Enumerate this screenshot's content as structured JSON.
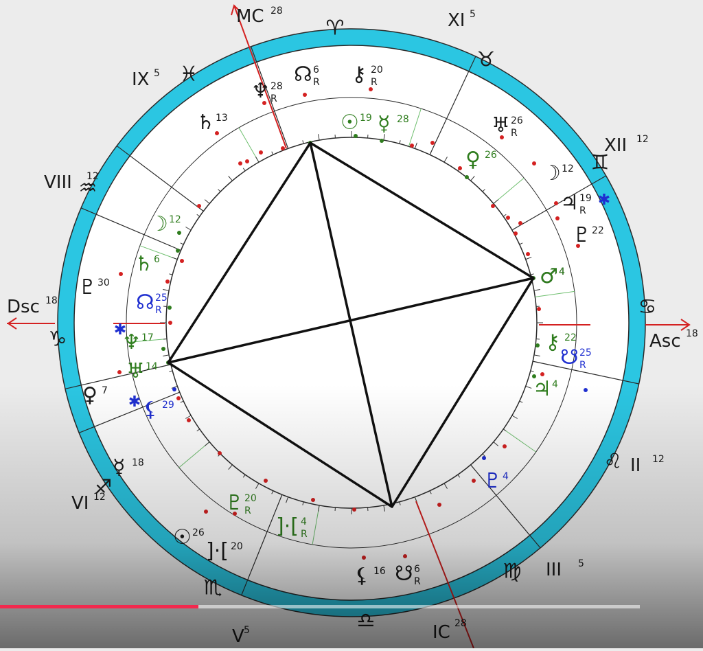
{
  "colors": {
    "ring": "#2bc6e2",
    "ring_edge": "#2a2a2a",
    "natal": "#1a1a1a",
    "transit": "#2f7d1e",
    "progressed": "#1f2fd0",
    "axis": "#d42121",
    "aspect": "#111111",
    "progress": "#f2294e"
  },
  "axes": {
    "mc": {
      "label": "MC",
      "deg": "28"
    },
    "ic": {
      "label": "IC",
      "deg": "28"
    },
    "asc": {
      "label": "Asc",
      "deg": "18"
    },
    "dsc": {
      "label": "Dsc",
      "deg": "18"
    }
  },
  "signs": [
    {
      "name": "aries-glyph",
      "glyph": "♈"
    },
    {
      "name": "taurus-glyph",
      "glyph": "♉"
    },
    {
      "name": "gemini-glyph",
      "glyph": "♊"
    },
    {
      "name": "cancer-glyph",
      "glyph": "♋"
    },
    {
      "name": "leo-glyph",
      "glyph": "♌"
    },
    {
      "name": "virgo-glyph",
      "glyph": "♍"
    },
    {
      "name": "libra-glyph",
      "glyph": "♎"
    },
    {
      "name": "scorpio-glyph",
      "glyph": "♏"
    },
    {
      "name": "sagittarius-glyph",
      "glyph": "♐"
    },
    {
      "name": "capricorn-glyph",
      "glyph": "♑"
    },
    {
      "name": "aquarius-glyph",
      "glyph": "♒"
    },
    {
      "name": "pisces-glyph",
      "glyph": "♓"
    }
  ],
  "houses": [
    {
      "label": "XI",
      "deg": "5"
    },
    {
      "label": "XII",
      "deg": "12"
    },
    {
      "label": "II",
      "deg": "12"
    },
    {
      "label": "III",
      "deg": "5"
    },
    {
      "label": "V",
      "deg": "5"
    },
    {
      "label": "VI",
      "deg": "12"
    },
    {
      "label": "VIII",
      "deg": "12"
    },
    {
      "label": "IX",
      "deg": "5"
    }
  ],
  "natal": [
    {
      "name": "node-north-natal",
      "glyph": "☊",
      "deg": "6",
      "retro": "R"
    },
    {
      "name": "chiron-natal",
      "glyph": "⚷",
      "deg": "20",
      "retro": "R"
    },
    {
      "name": "neptune-natal",
      "glyph": "♆",
      "deg": "28",
      "retro": "R"
    },
    {
      "name": "saturn-natal",
      "glyph": "♄",
      "deg": "13",
      "retro": ""
    },
    {
      "name": "uranus-natal",
      "glyph": "♅",
      "deg": "26",
      "retro": "R"
    },
    {
      "name": "moon-natal",
      "glyph": "☽",
      "deg": "12",
      "retro": ""
    },
    {
      "name": "jupiter-natal",
      "glyph": "♃",
      "deg": "19",
      "retro": "R"
    },
    {
      "name": "pluto-natal-right",
      "glyph": "♇",
      "deg": "22",
      "retro": ""
    },
    {
      "name": "mars-natal",
      "glyph": "♂",
      "deg": "4",
      "retro": ""
    },
    {
      "name": "node-south-natal",
      "glyph": "☋",
      "deg": "6",
      "retro": "R"
    },
    {
      "name": "lilith-natal",
      "glyph": "⚸",
      "deg": "16",
      "retro": ""
    },
    {
      "name": "sun-natal",
      "glyph": "☉",
      "deg": "26",
      "retro": ""
    },
    {
      "name": "vertex-natal",
      "glyph": "]·[",
      "deg": "20",
      "retro": ""
    },
    {
      "name": "mercury-natal",
      "glyph": "☿",
      "deg": "18",
      "retro": ""
    },
    {
      "name": "venus-natal",
      "glyph": "♀",
      "deg": "7",
      "retro": ""
    },
    {
      "name": "pluto-natal-left",
      "glyph": "♇",
      "deg": "30",
      "retro": ""
    }
  ],
  "transit": [
    {
      "name": "sun-transit",
      "glyph": "☉",
      "deg": "19",
      "retro": ""
    },
    {
      "name": "mercury-transit",
      "glyph": "☿",
      "deg": "28",
      "retro": ""
    },
    {
      "name": "venus-transit",
      "glyph": "♀",
      "deg": "26",
      "retro": ""
    },
    {
      "name": "moon-transit",
      "glyph": "☽",
      "deg": "12",
      "retro": ""
    },
    {
      "name": "saturn-transit",
      "glyph": "♄",
      "deg": "6",
      "retro": ""
    },
    {
      "name": "neptune-transit",
      "glyph": "♆",
      "deg": "17",
      "retro": ""
    },
    {
      "name": "uranus-transit",
      "glyph": "♅",
      "deg": "14",
      "retro": ""
    },
    {
      "name": "mars-transit",
      "glyph": "♂",
      "deg": "4",
      "retro": ""
    },
    {
      "name": "chiron-transit",
      "glyph": "⚷",
      "deg": "22",
      "retro": ""
    },
    {
      "name": "jupiter-transit",
      "glyph": "♃",
      "deg": "4",
      "retro": ""
    },
    {
      "name": "pluto-transit",
      "glyph": "♇",
      "deg": "20",
      "retro": "R"
    },
    {
      "name": "vertex-transit",
      "glyph": "]·[",
      "deg": "4",
      "retro": "R"
    }
  ],
  "progressed": [
    {
      "name": "node-north-progressed",
      "glyph": "☊",
      "deg": "25",
      "retro": "R"
    },
    {
      "name": "node-south-progressed",
      "glyph": "☋",
      "deg": "25",
      "retro": "R"
    },
    {
      "name": "lilith-progressed",
      "glyph": "⚸",
      "deg": "29",
      "retro": ""
    },
    {
      "name": "pluto-progressed",
      "glyph": "♇",
      "deg": "4",
      "retro": ""
    }
  ],
  "video": {
    "progress_fraction": 0.31
  }
}
